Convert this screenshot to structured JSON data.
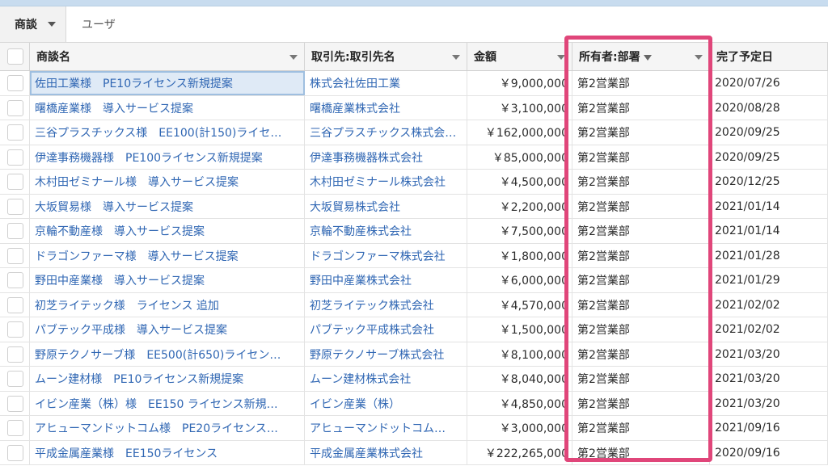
{
  "tabs": {
    "active": "商談",
    "user": "ユーザ"
  },
  "columns": [
    "商談名",
    "取引先:取引先名",
    "金額",
    "所有者:部署",
    "完了予定日"
  ],
  "rows": [
    {
      "name": "佐田工業様　PE10ライセンス新規提案",
      "account": "株式会社佐田工業",
      "amount": "￥9,000,000",
      "dept": "第2営業部",
      "date": "2020/07/26"
    },
    {
      "name": "曙橋産業様　導入サービス提案",
      "account": "曙橋産業株式会社",
      "amount": "￥3,100,000",
      "dept": "第2営業部",
      "date": "2020/08/28"
    },
    {
      "name": "三谷プラスチックス様　EE100(計150)ライセ…",
      "account": "三谷プラスチックス株式会…",
      "amount": "￥162,000,000",
      "dept": "第2営業部",
      "date": "2020/09/25"
    },
    {
      "name": "伊達事務機器様　PE100ライセンス新規提案",
      "account": "伊達事務機器株式会社",
      "amount": "￥85,000,000",
      "dept": "第2営業部",
      "date": "2020/09/25"
    },
    {
      "name": "木村田ゼミナール様　導入サービス提案",
      "account": "木村田ゼミナール株式会社",
      "amount": "￥4,500,000",
      "dept": "第2営業部",
      "date": "2020/12/25"
    },
    {
      "name": "大坂貿易様　導入サービス提案",
      "account": "大坂貿易株式会社",
      "amount": "￥2,200,000",
      "dept": "第2営業部",
      "date": "2021/01/14"
    },
    {
      "name": "京輪不動産様　導入サービス提案",
      "account": "京輪不動産株式会社",
      "amount": "￥7,500,000",
      "dept": "第2営業部",
      "date": "2021/01/14"
    },
    {
      "name": "ドラゴンファーマ様　導入サービス提案",
      "account": "ドラゴンファーマ株式会社",
      "amount": "￥1,800,000",
      "dept": "第2営業部",
      "date": "2021/01/28"
    },
    {
      "name": "野田中産業様　導入サービス提案",
      "account": "野田中産業株式会社",
      "amount": "￥6,000,000",
      "dept": "第2営業部",
      "date": "2021/01/29"
    },
    {
      "name": "初芝ライテック様　ライセンス 追加",
      "account": "初芝ライテック株式会社",
      "amount": "￥4,570,000",
      "dept": "第2営業部",
      "date": "2021/02/02"
    },
    {
      "name": "パブテック平成様　導入サービス提案",
      "account": "パブテック平成株式会社",
      "amount": "￥1,500,000",
      "dept": "第2営業部",
      "date": "2021/02/02"
    },
    {
      "name": "野原テクノサーブ様　EE500(計650)ライセン…",
      "account": "野原テクノサーブ株式会社",
      "amount": "￥8,100,000",
      "dept": "第2営業部",
      "date": "2021/03/20"
    },
    {
      "name": "ムーン建材様　PE10ライセンス新規提案",
      "account": "ムーン建材株式会社",
      "amount": "￥8,040,000",
      "dept": "第2営業部",
      "date": "2021/03/20"
    },
    {
      "name": "イビン産業（株）様　EE150 ライセンス新規…",
      "account": "イビン産業（株）",
      "amount": "￥4,850,000",
      "dept": "第2営業部",
      "date": "2021/03/20"
    },
    {
      "name": "アヒューマンドットコム様　PE20ライセンス…",
      "account": "アヒューマンドットコム…",
      "amount": "￥3,000,000",
      "dept": "第2営業部",
      "date": "2021/09/16"
    },
    {
      "name": "平成金属産業様　EE150ライセンス",
      "account": "平成金属産業株式会社",
      "amount": "￥222,265,000",
      "dept": "第2営業部",
      "date": "2020/09/16"
    }
  ]
}
